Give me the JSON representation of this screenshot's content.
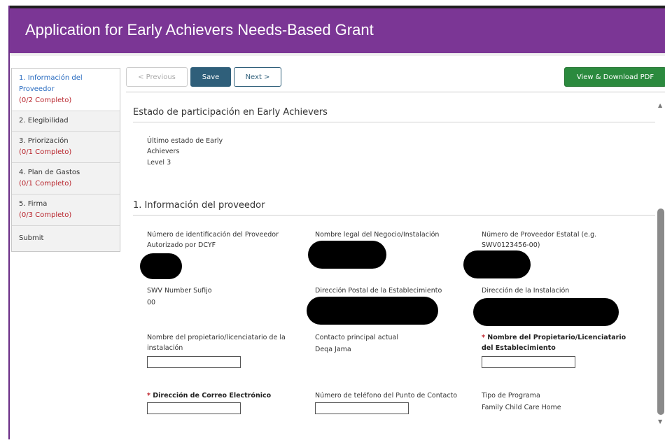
{
  "header": {
    "title": "Application for Early Achievers Needs-Based Grant"
  },
  "sidebar": {
    "items": [
      {
        "label": "1. Información del Proveedor",
        "count": "(0/2 Completo)"
      },
      {
        "label": "2. Elegibilidad",
        "count": ""
      },
      {
        "label": "3. Priorización",
        "count": "(0/1 Completo)"
      },
      {
        "label": "4. Plan de Gastos",
        "count": "(0/1 Completo)"
      },
      {
        "label": "5. Firma",
        "count": "(0/3 Completo)"
      },
      {
        "label": "Submit",
        "count": ""
      }
    ]
  },
  "toolbar": {
    "previous_label": "< Previous",
    "save_label": "Save",
    "next_label": "Next >",
    "pdf_label": "View & Download PDF"
  },
  "status_section": {
    "title": "Estado de participación en Early Achievers",
    "field_label_line1": "Último estado de Early",
    "field_label_line2": "Achievers",
    "field_value": "Level 3"
  },
  "provider_section": {
    "title": "1. Información del proveedor",
    "dcyf_id_line1": "Número de identificación del Proveedor",
    "dcyf_id_line2": "Autorizado por DCYF",
    "legal_name": "Nombre legal del Negocio/Instalación",
    "state_provider_line1": "Número de Proveedor Estatal (e.g.",
    "state_provider_line2": "SWV0123456-00)",
    "swv_suffix_label": "SWV Number Sufijo",
    "swv_suffix_value": "00",
    "postal_address": "Dirección Postal de la Establecimiento",
    "facility_address": "Dirección de la Instalación",
    "owner_name_line1": "Nombre del propietario/licenciatario de la",
    "owner_name_line2": "instalación",
    "contact_label": "Contacto principal actual",
    "contact_value": "Deqa Jama",
    "req_owner_line1": "Nombre del Propietario/Licenciatario",
    "req_owner_line2": "del Establecimiento",
    "email_label": "Dirección de Correo Electrónico",
    "phone_label": "Número de teléfono del Punto de Contacto",
    "program_type_label": "Tipo de Programa",
    "program_type_value": "Family Child Care Home",
    "required_mark": "*"
  },
  "scrollbar": {
    "up_icon": "▲",
    "down_icon": "▼"
  }
}
